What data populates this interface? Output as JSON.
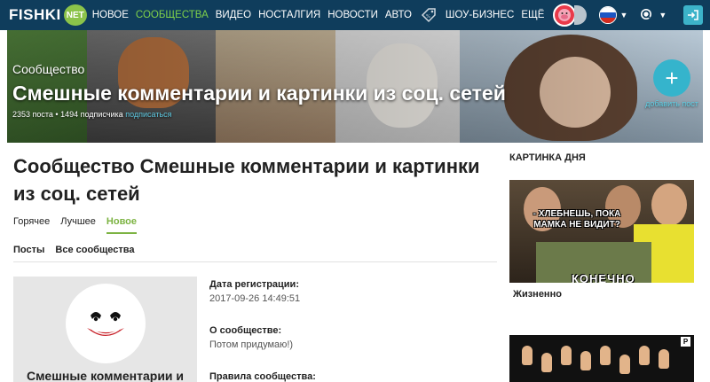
{
  "header": {
    "logo_text": "FISHKI",
    "logo_badge": "NET",
    "nav": [
      {
        "label": "НОВОЕ",
        "active": false
      },
      {
        "label": "СООБЩЕСТВА",
        "active": true
      },
      {
        "label": "ВИДЕО",
        "active": false
      },
      {
        "label": "НОСТАЛГИЯ",
        "active": false
      },
      {
        "label": "НОВОСТИ",
        "active": false
      },
      {
        "label": "АВТО",
        "active": false
      }
    ],
    "nav_after_icon": [
      {
        "label": "ШОУ-БИЗНЕС"
      },
      {
        "label": "ЕЩЁ"
      }
    ],
    "bg_color": "#0f3d5c",
    "active_color": "#7fd14a"
  },
  "banner": {
    "kicker": "Сообщество",
    "title": "Смешные комментарии и картинки из соц. сетей",
    "stats": "2353 поста • 1494 подписчика",
    "subscribe_link": "подписаться",
    "add_post_label": "добавить пост"
  },
  "main": {
    "title": "Сообщество Смешные комментарии и картинки из соц. сетей",
    "sort_tabs": [
      {
        "label": "Горячее",
        "active": false
      },
      {
        "label": "Лучшее",
        "active": false
      },
      {
        "label": "Новое",
        "active": true
      }
    ],
    "sub_tabs": [
      {
        "label": "Посты"
      },
      {
        "label": "Все сообщества"
      }
    ],
    "card": {
      "name": "Смешные комментарии и"
    },
    "info": {
      "reg_label": "Дата регистрации:",
      "reg_value": "2017-09-26 14:49:51",
      "about_label": "О сообществе:",
      "about_value": "Потом придумаю!)",
      "rules_label": "Правила сообщества:"
    }
  },
  "sidebar": {
    "heading": "КАРТИНКА ДНЯ",
    "meme_top": "- ХЛЕБНЕШЬ, ПОКА МАМКА НЕ ВИДИТ?",
    "meme_bottom": "КОНЕЧНО",
    "caption": "Жизненно",
    "badge": "P"
  }
}
